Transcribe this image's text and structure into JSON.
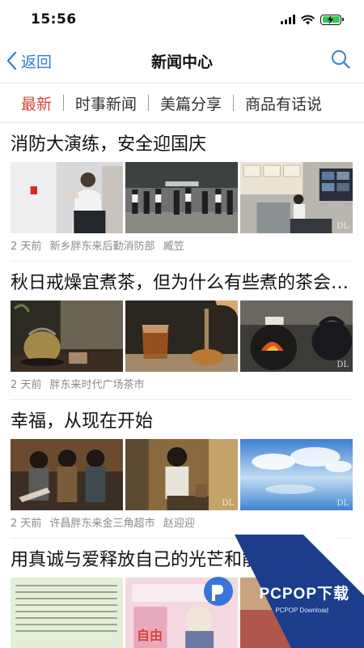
{
  "status_bar": {
    "time": "15:56"
  },
  "nav": {
    "back_label": "返回",
    "title": "新闻中心"
  },
  "tabs": [
    {
      "label": "最新",
      "active": true
    },
    {
      "label": "时事新闻",
      "active": false
    },
    {
      "label": "美篇分享",
      "active": false
    },
    {
      "label": "商品有话说",
      "active": false
    }
  ],
  "news": [
    {
      "title": "消防大演练，安全迎国庆",
      "time": "2 天前",
      "source": "新乡胖东来后勤消防部",
      "author": "臧笠"
    },
    {
      "title": "秋日戒燥宜煮茶，但为什么有些煮的茶会更好喝",
      "time": "2 天前",
      "source": "胖东来时代广场茶市",
      "author": ""
    },
    {
      "title": "幸福，从现在开始",
      "time": "2 天前",
      "source": "许昌胖东来金三角超市",
      "author": "赵迎迎"
    },
    {
      "title": "用真诚与爱释放自己的光芒和能量",
      "time": "",
      "source": "",
      "author": ""
    }
  ],
  "thumb_watermark": "DL",
  "poster_caption": "自由",
  "logo": {
    "text": "PCPOP下载",
    "sub": "PCPOP Download"
  }
}
